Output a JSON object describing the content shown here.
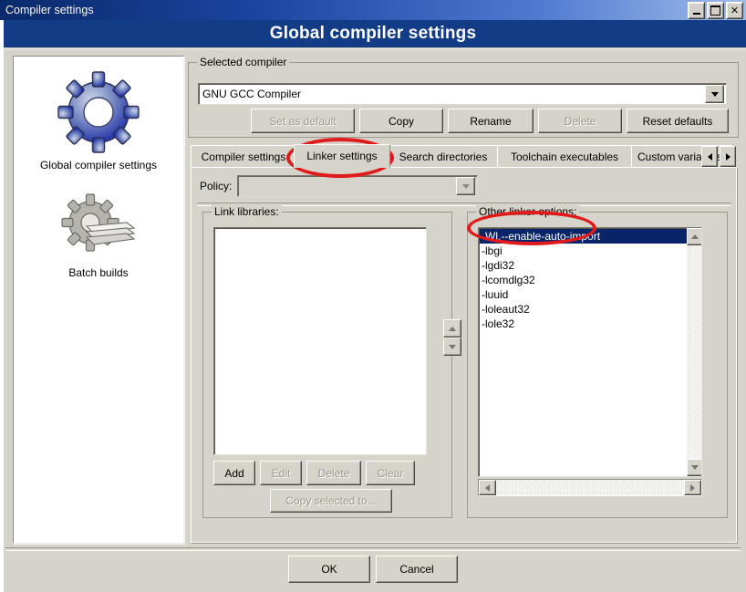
{
  "window": {
    "title": "Compiler settings",
    "controls": [
      {
        "name": "minimize",
        "label": "_"
      },
      {
        "name": "maximize",
        "label": "□"
      },
      {
        "name": "close",
        "label": "✕"
      }
    ]
  },
  "header": {
    "title": "Global compiler settings",
    "bg_color": "#123c86",
    "text_color": "#ffffff"
  },
  "sidebar": {
    "items": [
      {
        "label": "Global compiler settings",
        "icon": "gear-icon",
        "selected": true
      },
      {
        "label": "Batch builds",
        "icon": "gear-stack-icon",
        "selected": false
      }
    ]
  },
  "selected_compiler": {
    "group_title": "Selected compiler",
    "combo_value": "GNU GCC Compiler",
    "buttons": [
      {
        "label": "Set as default",
        "enabled": false
      },
      {
        "label": "Copy",
        "enabled": true
      },
      {
        "label": "Rename",
        "enabled": true
      },
      {
        "label": "Delete",
        "enabled": false
      },
      {
        "label": "Reset defaults",
        "enabled": true
      }
    ]
  },
  "tabs": {
    "items": [
      {
        "label": "Compiler settings",
        "selected": false
      },
      {
        "label": "Linker settings",
        "selected": true
      },
      {
        "label": "Search directories",
        "selected": false
      },
      {
        "label": "Toolchain executables",
        "selected": false
      },
      {
        "label": "Custom variables",
        "selected": false
      }
    ],
    "scroll_left": "◀",
    "scroll_right": "▶"
  },
  "policy": {
    "label": "Policy:",
    "value": "",
    "enabled": false
  },
  "link_libraries": {
    "group_title": "Link libraries:",
    "items": [],
    "buttons": [
      {
        "label": "Add",
        "enabled": true
      },
      {
        "label": "Edit",
        "enabled": false
      },
      {
        "label": "Delete",
        "enabled": false
      },
      {
        "label": "Clear",
        "enabled": false
      }
    ],
    "copy_selected_label": "Copy selected to...",
    "copy_selected_enabled": false
  },
  "reorder": {
    "up_label": "▲",
    "down_label": "▼"
  },
  "other_linker_options": {
    "group_title": "Other linker options:",
    "items": [
      {
        "text": "-Wl,--enable-auto-import",
        "selected": true
      },
      {
        "text": "-lbgi",
        "selected": false
      },
      {
        "text": "-lgdi32",
        "selected": false
      },
      {
        "text": "-lcomdlg32",
        "selected": false
      },
      {
        "text": "-luuid",
        "selected": false
      },
      {
        "text": "-loleaut32",
        "selected": false
      },
      {
        "text": "-lole32",
        "selected": false
      }
    ],
    "selection_color": "#0a246a"
  },
  "dialog_buttons": {
    "ok": "OK",
    "cancel": "Cancel"
  },
  "annotations": {
    "color": "#e01b1b",
    "highlights": [
      "Linker settings tab",
      "Other linker options label"
    ]
  }
}
